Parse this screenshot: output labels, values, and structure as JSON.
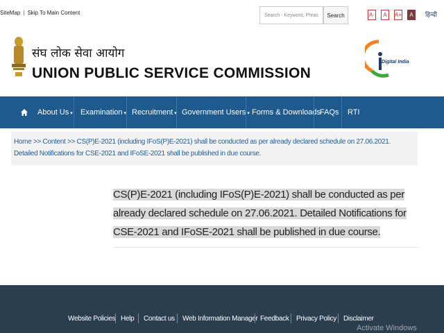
{
  "toplinks": {
    "sitemap": "SiteMap",
    "separator": "|",
    "skip": "Skip To Main Content"
  },
  "search": {
    "placeholder": "Search - Keyword, Phrase",
    "button": "Search"
  },
  "font_controls": {
    "decrease": "A-",
    "normal": "A",
    "increase": "A+",
    "contrast": "A"
  },
  "language": "हिन्दी",
  "header": {
    "hindi_name": "संघ लोक सेवा आयोग",
    "english_name": "UNION PUBLIC SERVICE COMMISSION",
    "digital_india": "Digital India"
  },
  "nav": {
    "about": "About Us",
    "examination": "Examination",
    "recruitment": "Recruitment",
    "government_users": "Government Users",
    "forms": "Forms & Downloads",
    "faqs": "FAQs",
    "rti": "RTI",
    "caret": "▾"
  },
  "breadcrumb": {
    "home": "Home",
    "sep": ">>",
    "content": "Content",
    "current": "CS(P)E-2021 (including IFoS(P)E-2021) shall be conducted as per already declared schedule on 27.06.2021. Detailed Notifications for CSE-2021 and IFoSE-2021 shall be published in due course."
  },
  "content": {
    "text": "CS(P)E-2021 (including IFoS(P)E-2021) shall be conducted as per already declared schedule on 27.06.2021. Detailed Notifications for CSE-2021 and IFoSE-2021 shall be published in due course."
  },
  "footer": {
    "website_policies": "Website Policies",
    "help": "Help",
    "contact": "Contact us",
    "web_manager": "Web Information Manager",
    "feedback": "Feedback",
    "privacy": "Privacy Policy",
    "disclaimer": "Disclaimer"
  },
  "watermark": "Activate Windows",
  "colors": {
    "nav": "#1e5a8e",
    "footer": "#2b3e50",
    "link": "#1f5fa0",
    "accent": "#c0392b"
  }
}
